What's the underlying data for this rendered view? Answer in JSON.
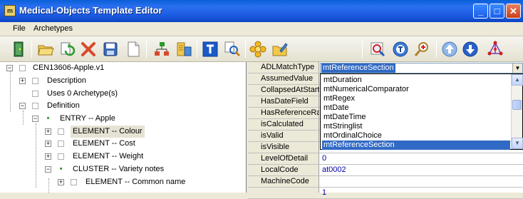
{
  "window": {
    "title": "Medical-Objects Template Editor",
    "icon": "app-icon",
    "icon_glyph": "m",
    "controls": [
      "_",
      "□",
      "✕"
    ]
  },
  "menu": {
    "file": "File",
    "archetypes": "Archetypes"
  },
  "toolbar": {
    "icons": [
      "exit-door-icon",
      "open-folder-icon",
      "refresh-icon",
      "delete-x-icon",
      "save-disk-icon",
      "new-document-icon",
      "tree-structure-icon",
      "database-icon",
      "text-t-icon",
      "find-replace-icon",
      "flower-icon",
      "folder-edit-icon",
      "zoom-tool-icon",
      "template-t-icon",
      "search-add-icon",
      "arrow-up-icon",
      "arrow-down-icon",
      "network-node-icon"
    ]
  },
  "tree": {
    "items": [
      {
        "label": "CEN13606-Apple.v1",
        "expander": "−"
      },
      {
        "label": "Description",
        "expander": "+"
      },
      {
        "label": "Uses 0 Archetype(s)",
        "expander": ""
      },
      {
        "label": "Definition",
        "expander": "−"
      },
      {
        "label": "ENTRY -- Apple",
        "expander": "−"
      },
      {
        "label": "ELEMENT -- Colour",
        "expander": "+"
      },
      {
        "label": "ELEMENT -- Cost",
        "expander": "+"
      },
      {
        "label": "ELEMENT -- Weight",
        "expander": "+"
      },
      {
        "label": "CLUSTER -- Variety notes",
        "expander": "−"
      },
      {
        "label": "ELEMENT -- Common name",
        "expander": "+"
      }
    ]
  },
  "properties": {
    "rows": [
      {
        "name": "ADLMatchType",
        "value": ""
      },
      {
        "name": "AssumedValue",
        "value": ""
      },
      {
        "name": "CollapsedAtStart",
        "value": ""
      },
      {
        "name": "HasDateField",
        "value": ""
      },
      {
        "name": "HasReferenceRa",
        "value": ""
      },
      {
        "name": "isCalculated",
        "value": ""
      },
      {
        "name": "isValid",
        "value": ""
      },
      {
        "name": "isVisible",
        "value": ""
      },
      {
        "name": "LevelOfDetail",
        "value": "0"
      },
      {
        "name": "LocalCode",
        "value": "at0002"
      },
      {
        "name": "MachineCode",
        "value": ""
      },
      {
        "name": "",
        "value": "1"
      }
    ]
  },
  "combo": {
    "value": "mtReferenceSection",
    "arrow": "▼"
  },
  "dropdown": {
    "options": [
      "mtDuration",
      "mtNumericalComparator",
      "mtRegex",
      "mtDate",
      "mtDateTime",
      "mtStringlist",
      "mtOrdinalChoice",
      "mtReferenceSection"
    ],
    "selected": "mtReferenceSection",
    "scroll_up": "▲",
    "scroll_down": "▼"
  }
}
